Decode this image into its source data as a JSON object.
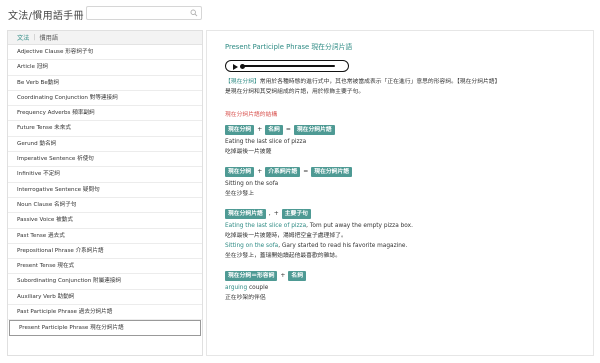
{
  "header": {
    "app_title": "文法/慣用語手冊",
    "search_placeholder": ""
  },
  "sidebar": {
    "tabs": [
      {
        "label": "文法",
        "active": true
      },
      {
        "label": "慣用語",
        "active": false
      }
    ],
    "items": [
      {
        "label": "Adjective Clause 形容詞子句"
      },
      {
        "label": "Article 冠詞"
      },
      {
        "label": "Be Verb Be動詞"
      },
      {
        "label": "Coordinating Conjunction 對等連接詞"
      },
      {
        "label": "Frequency Adverbs 頻率副詞"
      },
      {
        "label": "Future Tense 未來式"
      },
      {
        "label": "Gerund 動名詞"
      },
      {
        "label": "Imperative Sentence 祈使句"
      },
      {
        "label": "Infinitive 不定詞"
      },
      {
        "label": "Interrogative Sentence 疑問句"
      },
      {
        "label": "Noun Clause 名詞子句"
      },
      {
        "label": "Passive Voice 被動式"
      },
      {
        "label": "Past Tense 過去式"
      },
      {
        "label": "Prepositional Phrase 介系詞片語"
      },
      {
        "label": "Present Tense 現在式"
      },
      {
        "label": "Subordinating Conjunction 附屬連接詞"
      },
      {
        "label": "Auxiliary Verb 助動詞"
      },
      {
        "label": "Past Participle Phrase 過去分詞片語"
      },
      {
        "label": "Present Participle Phrase 現在分詞片語",
        "selected": true
      }
    ]
  },
  "content": {
    "title": "Present Participle Phrase 現在分詞片語",
    "desc_part1": "【現在分詞】",
    "desc_part2": "常用於各種時態的進行式中，其也常被當成表示「正在進行」意思的形容詞。",
    "desc_part3": "【現在分詞片語】",
    "desc_line2": "是現在分詞和其受詞組成的片語，用於修飾主要子句。",
    "section_head": "現在分詞片語的結構",
    "blocks": [
      {
        "chips": [
          "現在分詞",
          "名詞",
          "現在分詞片語"
        ],
        "ops": [
          "+",
          "="
        ],
        "en": "Eating the last slice of pizza",
        "zh": "吃掉最後一片披薩"
      },
      {
        "chips": [
          "現在分詞",
          "介系詞片語",
          "現在分詞片語"
        ],
        "ops": [
          "+",
          "="
        ],
        "en": "Sitting on the sofa",
        "zh": "坐在沙發上"
      },
      {
        "chips": [
          "現在分詞片語",
          "主要子句"
        ],
        "ops": [
          ",",
          "+"
        ],
        "en1_green": "Eating the last slice of pizza",
        "en1_rest": ", Tom put away the empty pizza box.",
        "zh1": "吃掉最後一片披薩時，湯姆把空盒子處理掉了。",
        "en2_green": "Sitting on the sofa",
        "en2_rest": ", Gary started to read his favorite magazine.",
        "zh2": "坐在沙發上，蓋瑞開始讀起他最喜歡的雜誌。"
      },
      {
        "chips": [
          "現在分詞＝形容詞",
          "名詞"
        ],
        "ops": [
          "+"
        ],
        "en_green": "arguing",
        "en_rest": " couple",
        "zh": "正在吵架的伴侶"
      }
    ]
  },
  "colors": {
    "accent": "#2e8b84",
    "chip": "#4e9a94",
    "section_head": "#d9534f"
  }
}
